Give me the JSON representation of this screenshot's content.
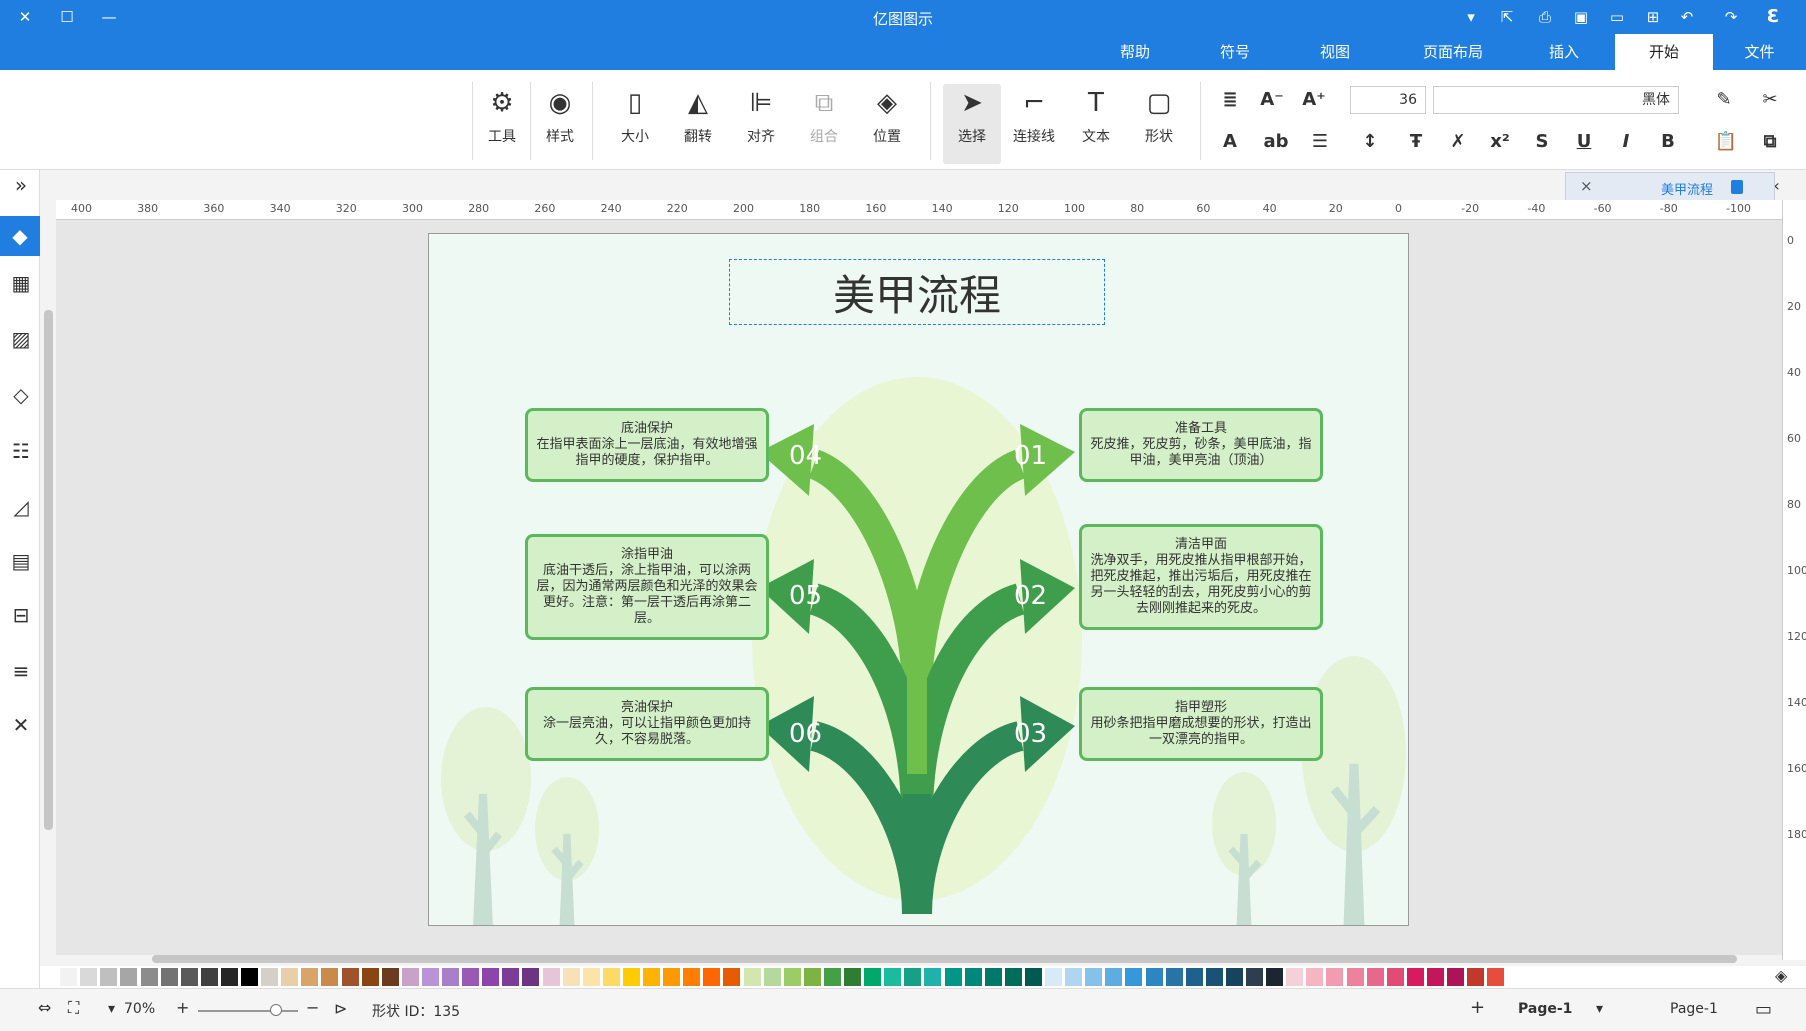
{
  "app": {
    "title": "亿图图示"
  },
  "title_controls": {
    "close": "✕",
    "maximize": "☐",
    "minimize": "—"
  },
  "ribbon": {
    "tabs": [
      "文件",
      "开始",
      "插入",
      "页面布局",
      "视图",
      "符号",
      "帮助"
    ],
    "active_tab": "开始"
  },
  "toolbar": {
    "tools": [
      "形状",
      "文本",
      "连接线",
      "选择",
      "位置",
      "组合",
      "对齐",
      "翻转",
      "大小",
      "样式",
      "工具"
    ],
    "selected_tool": "选择",
    "disabled_tool": "组合",
    "font_name": "黑体",
    "font_size": "36"
  },
  "document_tab": {
    "label": "美甲流程",
    "close": "×"
  },
  "ruler": {
    "h_ticks": [
      "-100",
      "-80",
      "-60",
      "-40",
      "-20",
      "0",
      "20",
      "40",
      "60",
      "80",
      "100",
      "120",
      "140",
      "160",
      "180",
      "200",
      "220",
      "240",
      "260",
      "280",
      "300",
      "320",
      "340",
      "360",
      "380",
      "400"
    ],
    "v_ticks": [
      "0",
      "20",
      "40",
      "60",
      "80",
      "100",
      "120",
      "140",
      "160",
      "180"
    ]
  },
  "diagram": {
    "title": "美甲流程",
    "steps": [
      {
        "number": "01",
        "heading": "准备工具",
        "body": "死皮推，死皮剪，砂条，美甲底油，指甲油，美甲亮油（顶油）"
      },
      {
        "number": "02",
        "heading": "清洁甲面",
        "body": "洗净双手，用死皮推从指甲根部开始，把死皮推起，推出污垢后，用死皮推在另一头轻轻的刮去，用死皮剪小心的剪去刚刚推起来的死皮。"
      },
      {
        "number": "03",
        "heading": "指甲塑形",
        "body": "用砂条把指甲磨成想要的形状，打造出一双漂亮的指甲。"
      },
      {
        "number": "04",
        "heading": "底油保护",
        "body": "在指甲表面涂上一层底油，有效地增强指甲的硬度，保护指甲。"
      },
      {
        "number": "05",
        "heading": "涂指甲油",
        "body": "底油干透后，涂上指甲油，可以涂两层，因为通常两层颜色和光泽的效果会更好。注意：第一层干透后再涂第二层。"
      },
      {
        "number": "06",
        "heading": "亮油保护",
        "body": "涂一层亮油，可以让指甲颜色更加持久，不容易脱落。"
      }
    ],
    "colors": {
      "light_arrow": "#6ebf4b",
      "mid_arrow": "#3f9e4c",
      "dark_arrow": "#2e8b57",
      "box_border": "#5cb85c",
      "box_fill": "#d4f0c8",
      "blob": "#e9f6d5",
      "tree": "#c7dfd2"
    }
  },
  "status": {
    "page_label": "Page-1",
    "page_tab": "Page-1",
    "shape_id": "形状 ID：135",
    "zoom": "70%"
  },
  "palette_colors": [
    "#ffffff",
    "#f2f2f2",
    "#d9d9d9",
    "#bfbfbf",
    "#a6a6a6",
    "#8c8c8c",
    "#737373",
    "#595959",
    "#404040",
    "#262626",
    "#000000",
    "#d4d0c8",
    "#e8cfa9",
    "#d9a46a",
    "#c98a4b",
    "#a0522d",
    "#8b4513",
    "#6b3a1f",
    "#c8a2c8",
    "#b993d6",
    "#a87fc9",
    "#9b59b6",
    "#8e44ad",
    "#7d3c98",
    "#6c3483",
    "#e8c4d8",
    "#f7e1b5",
    "#fce4a8",
    "#ffd966",
    "#ffcc00",
    "#ffb300",
    "#ff9900",
    "#ff8000",
    "#ff6600",
    "#e65c00",
    "#d0e8b0",
    "#b5d99c",
    "#9ccc65",
    "#7cb342",
    "#43a047",
    "#2e7d32",
    "#00a86b",
    "#1abc9c",
    "#16a085",
    "#20b2aa",
    "#009688",
    "#00897b",
    "#00796b",
    "#006d5b",
    "#005a4f",
    "#d6eaf8",
    "#aed6f1",
    "#85c1e9",
    "#5dade2",
    "#3498db",
    "#2e86c1",
    "#2874a6",
    "#1f618d",
    "#1a5276",
    "#154360",
    "#2c3e50",
    "#1b2631",
    "#f5d0d8",
    "#f4b6c2",
    "#f19cb0",
    "#ee829e",
    "#e8688c",
    "#e14b74",
    "#d81b60",
    "#c2185b",
    "#ad1457",
    "#c0392b",
    "#e74c3c"
  ]
}
